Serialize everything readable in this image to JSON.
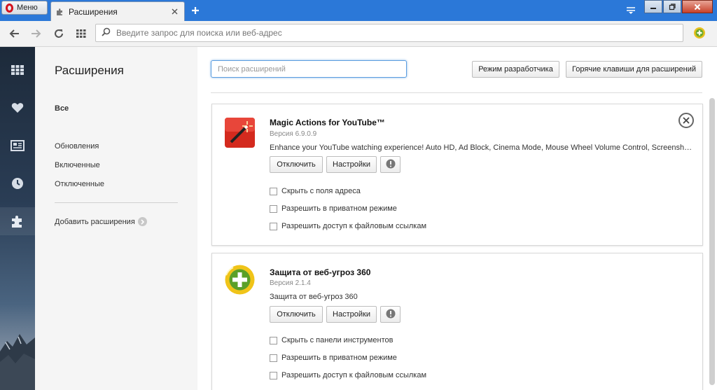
{
  "window": {
    "menu_label": "Меню",
    "tab_title": "Расширения"
  },
  "navbar": {
    "address_placeholder": "Введите запрос для поиска или веб-адрес"
  },
  "sidebar_icons": [
    "speed-dial-icon",
    "heart-icon",
    "news-icon",
    "history-icon",
    "extensions-icon"
  ],
  "leftnav": {
    "title": "Расширения",
    "items": [
      {
        "label": "Все",
        "bold": true
      },
      {
        "label": "Обновления"
      },
      {
        "label": "Включенные"
      },
      {
        "label": "Отключенные"
      }
    ],
    "add_label": "Добавить расширения"
  },
  "main": {
    "search_placeholder": "Поиск расширений",
    "dev_mode_label": "Режим разработчика",
    "hotkeys_label": "Горячие клавиши для расширений",
    "extensions": [
      {
        "name": "Magic Actions for YouTube™",
        "version": "Версия 6.9.0.9",
        "description": "Enhance your YouTube watching experience! Auto HD, Ad Block, Cinema Mode, Mouse Wheel Volume Control, Screenshot...",
        "disable_label": "Отключить",
        "settings_label": "Настройки",
        "options": [
          "Скрыть с поля адреса",
          "Разрешить в приватном режиме",
          "Разрешить доступ к файловым ссылкам"
        ]
      },
      {
        "name": "Защита от веб-угроз 360",
        "version": "Версия 2.1.4",
        "description": "Защита от веб-угроз 360",
        "disable_label": "Отключить",
        "settings_label": "Настройки",
        "options": [
          "Скрыть с панели инструментов",
          "Разрешить в приватном режиме",
          "Разрешить доступ к файловым ссылкам"
        ]
      }
    ]
  },
  "colors": {
    "titlebar": "#2b78d8",
    "opera_red": "#d4121e",
    "accent_focus": "#5a9de0"
  }
}
